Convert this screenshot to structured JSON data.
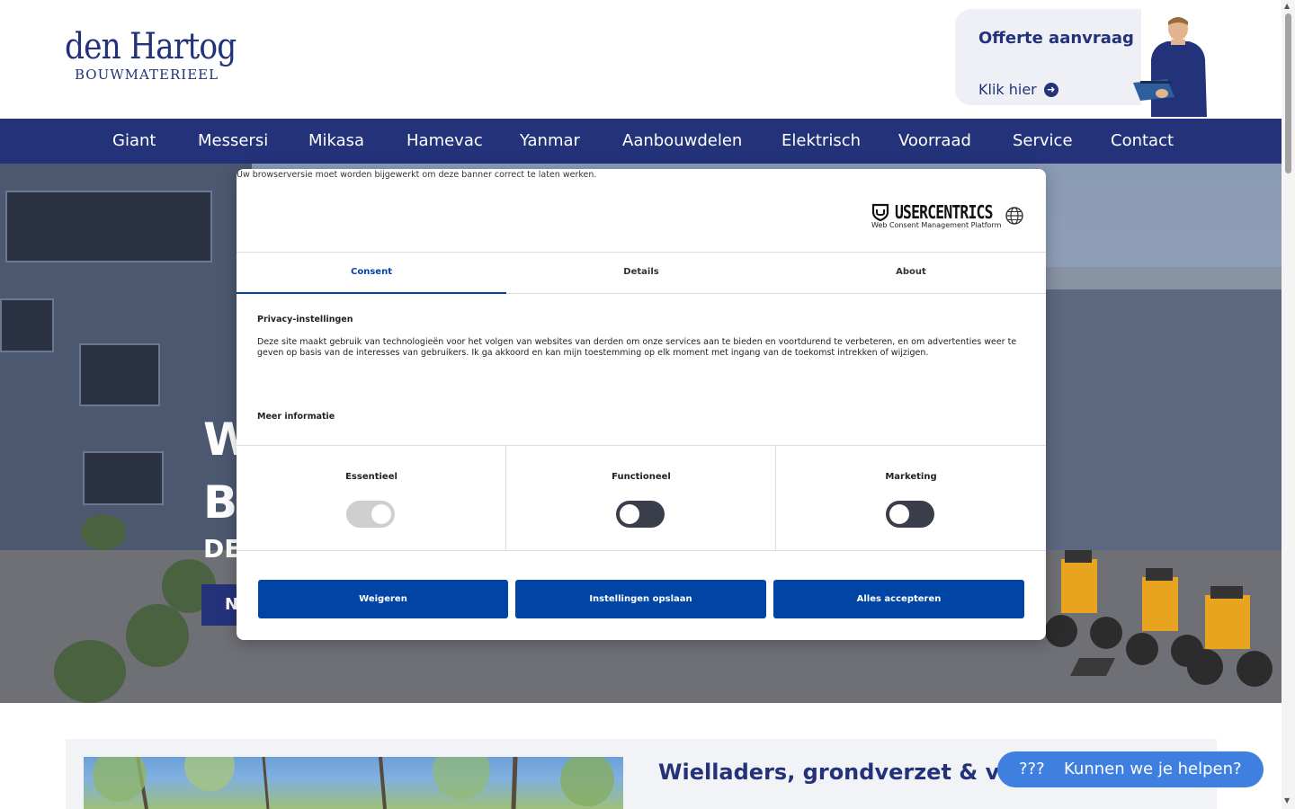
{
  "header": {
    "logo_line1": "den Hartog",
    "logo_line2": "BOUWMATERIEEL",
    "offer_title": "Offerte aanvraag",
    "offer_link": "Klik hier"
  },
  "nav": {
    "items": [
      "Giant",
      "Messersi",
      "Mikasa",
      "Hamevac",
      "Yanmar",
      "Aanbouwdelen",
      "Elektrisch",
      "Voorraad",
      "Service",
      "Contact"
    ]
  },
  "hero": {
    "line1_partial": "W",
    "line2_partial": "B",
    "line3_partial": "DE",
    "button_partial": "N"
  },
  "consent": {
    "browser_warning": "Uw browserversie moet worden bijgewerkt om deze banner correct te laten werken.",
    "brand": "USERCENTRICS",
    "brand_sub": "Web Consent Management Platform",
    "tabs": [
      "Consent",
      "Details",
      "About"
    ],
    "active_tab": "Consent",
    "section_title": "Privacy-instellingen",
    "section_text": "Deze site maakt gebruik van technologieën voor het volgen van websites van derden om onze services aan te bieden en voortdurend te verbeteren, en om advertenties weer te geven op basis van de interesses van gebruikers. Ik ga akkoord en kan mijn toestemming op elk moment met ingang van de toekomst intrekken of wijzigen.",
    "more_info": "Meer informatie",
    "toggles": [
      {
        "label": "Essentieel",
        "state": "on-disabled"
      },
      {
        "label": "Functioneel",
        "state": "off"
      },
      {
        "label": "Marketing",
        "state": "off"
      }
    ],
    "buttons": {
      "deny": "Weigeren",
      "save": "Instellingen opslaan",
      "accept_all": "Alles accepteren"
    }
  },
  "content": {
    "heading": "Wielladers, grondverzet & verdi"
  },
  "chat": {
    "icon_text": "???",
    "label": "Kunnen we je helpen?"
  },
  "colors": {
    "brand_navy": "#24327a",
    "consent_blue": "#0045a5",
    "chat_blue": "#3e7fe0",
    "toggle_off": "#3a3d4a",
    "toggle_disabled": "#cfcfcf"
  }
}
